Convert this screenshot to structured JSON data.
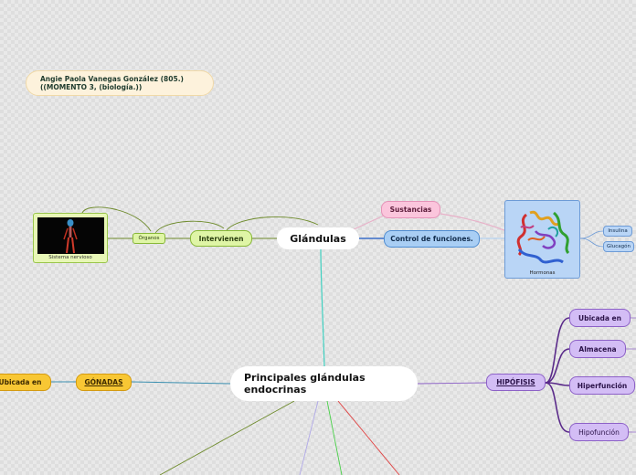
{
  "author_note": {
    "line1": "Angie Paola Vanegas González (805.)",
    "line2": "((MOMENTO 3, (biología.))"
  },
  "root_topic": {
    "line1": "Principales glándulas",
    "line2": "endocrinas"
  },
  "glandulas": "Glándulas",
  "intervienen": "Intervienen",
  "organos": "Órganos",
  "sistema_nervioso": "Sistema nervioso",
  "sustancias": "Sustancias",
  "control_funciones": "Control de funciones.",
  "hormonas": "Hormonas",
  "insulina": "Insulina",
  "glucagon": "Glucagón",
  "gonadas": "GÓNADAS",
  "gonadas_ubicada": "Ubicada en",
  "hipofisis": "HIPÓFISIS",
  "hipofisis_children": [
    "Ubicada en",
    "Almacena",
    "Hiperfunción",
    "Hipofunción"
  ],
  "colors": {
    "green_branch": "#6d8a2a",
    "teal_connector": "#3fd0c0",
    "purple_branch": "#5a2a8a",
    "orange_branch": "#3a8fb0",
    "red_branch": "#e04040",
    "lilac_branch": "#b0a8e8",
    "green2_branch": "#49d049",
    "pink_branch": "#e8b0c8",
    "blue_branch": "#3a6fc8"
  }
}
